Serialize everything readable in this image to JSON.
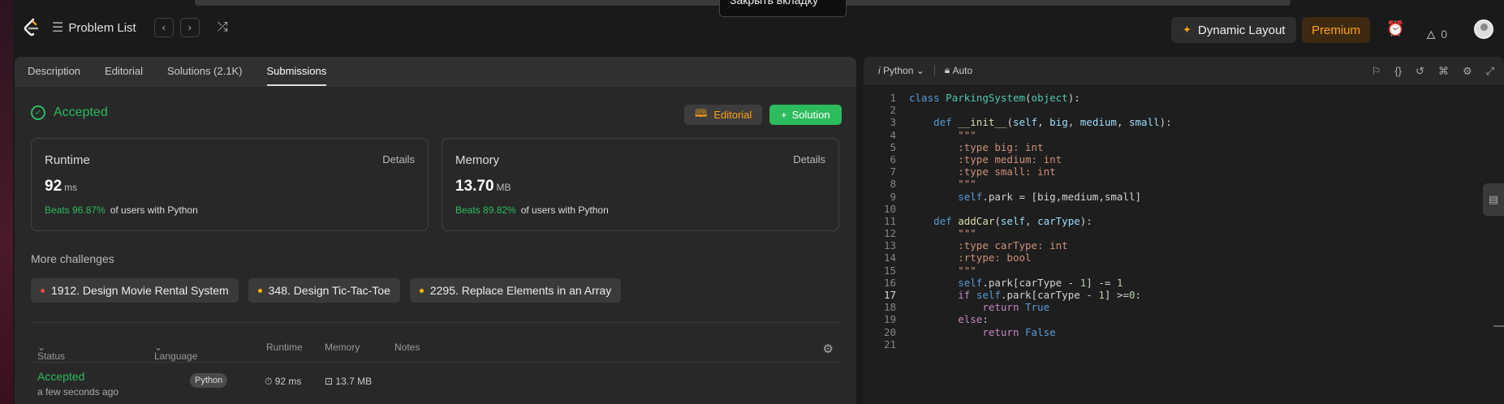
{
  "browser": {
    "tooltip": "Закрыть вкладку"
  },
  "nav": {
    "problem_list": "Problem List",
    "prev_icon": "chevron-left-icon",
    "next_icon": "chevron-right-icon",
    "shuffle_icon": "shuffle-icon",
    "dynamic_layout": "Dynamic Layout",
    "premium": "Premium",
    "streak_count": "0"
  },
  "left_tabs": [
    {
      "label": "Description"
    },
    {
      "label": "Editorial"
    },
    {
      "label": "Solutions (2.1K)"
    },
    {
      "label": "Submissions",
      "active": true
    }
  ],
  "result": {
    "status": "Accepted",
    "editorial_btn": "Editorial",
    "solution_btn": "Solution",
    "runtime": {
      "label": "Runtime",
      "details": "Details",
      "value": "92",
      "unit": "ms",
      "beats": "Beats 96.87%",
      "suffix": "of users with Python"
    },
    "memory": {
      "label": "Memory",
      "details": "Details",
      "value": "13.70",
      "unit": "MB",
      "beats": "Beats 89.82%",
      "suffix": "of users with Python"
    }
  },
  "challenges": {
    "title": "More challenges",
    "items": [
      {
        "label": "1912. Design Movie Rental System",
        "color": "#ef4743"
      },
      {
        "label": "348. Design Tic-Tac-Toe",
        "color": "#ffb800"
      },
      {
        "label": "2295. Replace Elements in an Array",
        "color": "#ffb800"
      }
    ]
  },
  "submissions_table": {
    "headers": {
      "status": "Status",
      "language": "Language",
      "runtime": "Runtime",
      "memory": "Memory",
      "notes": "Notes"
    },
    "rows": [
      {
        "status": "Accepted",
        "time": "a few seconds ago",
        "language": "Python",
        "runtime": "92 ms",
        "memory": "13.7 MB"
      }
    ]
  },
  "editor": {
    "language": "Python",
    "mode": "Auto",
    "current_line": 17,
    "line_numbers": [
      "1",
      "2",
      "3",
      "4",
      "5",
      "6",
      "7",
      "8",
      "9",
      "10",
      "11",
      "12",
      "13",
      "14",
      "15",
      "16",
      "17",
      "18",
      "19",
      "20",
      "21"
    ]
  },
  "colors": {
    "accent": "#ffa116",
    "success": "#2cbb5d",
    "hard": "#ef4743",
    "medium": "#ffb800"
  }
}
